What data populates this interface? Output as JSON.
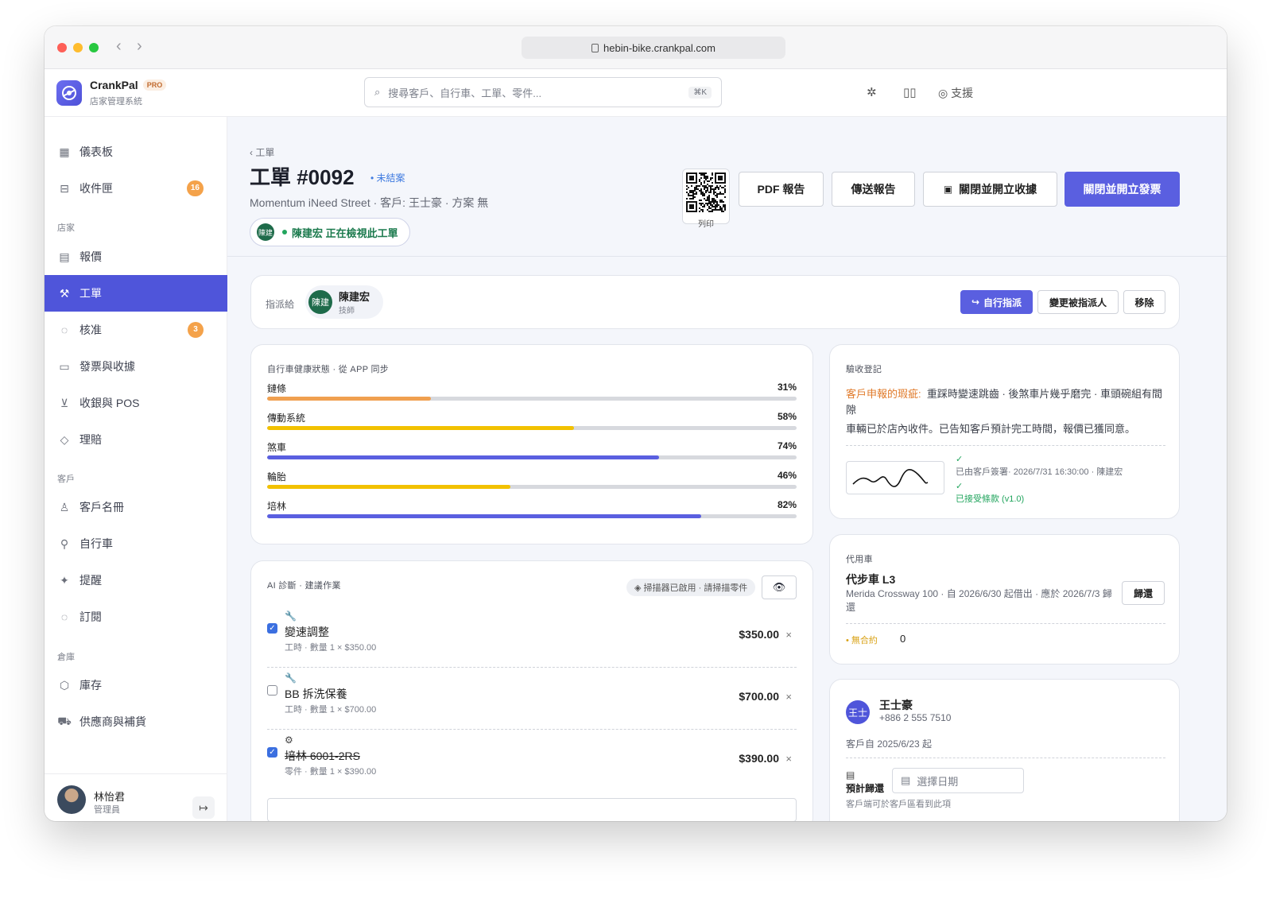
{
  "browser": {
    "url": "hebin-bike.crankpal.com"
  },
  "app": {
    "name": "CrankPal",
    "badge": "PRO",
    "subtitle": "店家管理系統"
  },
  "search": {
    "placeholder": "搜尋客戶、自行車、工單、零件...",
    "shortcut": "⌘K"
  },
  "header": {
    "support_label": "支援"
  },
  "sidebar": {
    "dashboard": "儀表板",
    "inbox": "收件匣",
    "inbox_count": "16",
    "section_store": "店家",
    "quotes": "報價",
    "work_orders": "工單",
    "approvals": "核准",
    "approvals_count": "3",
    "invoices": "發票與收據",
    "pos": "收銀與 POS",
    "claims": "理賠",
    "section_customers": "客戶",
    "directory": "客戶名冊",
    "bikes": "自行車",
    "reminders": "提醒",
    "subscriptions": "訂閱",
    "section_warehouse": "倉庫",
    "inventory": "庫存",
    "suppliers": "供應商與補貨"
  },
  "user": {
    "name": "林怡君",
    "role": "管理員"
  },
  "order": {
    "breadcrumb": "‹ 工單",
    "title": "工單 #0092",
    "status": "• 未結案",
    "subtitle": "Momentum iNeed Street · 客戶: 王士豪 · 方案 無",
    "viewer_initials": "陳建",
    "viewer_text": "陳建宏 正在檢視此工單",
    "qr_label": "列印"
  },
  "actions": {
    "pdf": "PDF 報告",
    "send": "傳送報告",
    "close_receipt": "關閉並開立收據",
    "close_invoice": "關閉並開立發票"
  },
  "assign": {
    "label": "指派給",
    "initials": "陳建",
    "name": "陳建宏",
    "role": "技師",
    "self_assign": "自行指派",
    "change": "變更被指派人",
    "remove": "移除"
  },
  "health": {
    "title": "自行車健康狀態 · 從 APP 同步",
    "items": [
      {
        "label": "鏈條",
        "pct": "31%",
        "value": 31,
        "color": "#f0a050"
      },
      {
        "label": "傳動系統",
        "pct": "58%",
        "value": 58,
        "color": "#f2c100"
      },
      {
        "label": "煞車",
        "pct": "74%",
        "value": 74,
        "color": "#5a5fe0"
      },
      {
        "label": "輪胎",
        "pct": "46%",
        "value": 46,
        "color": "#f2c100"
      },
      {
        "label": "培林",
        "pct": "82%",
        "value": 82,
        "color": "#5a5fe0"
      }
    ]
  },
  "ai": {
    "title": "AI 診斷 · 建議作業",
    "scanner": "◈ 掃描器已啟用 · 請掃描零件",
    "eye_icon": "👁",
    "jobs": [
      {
        "icon": "🔧",
        "name": "變速調整",
        "meta": "工時 · 數量 1 × $350.00",
        "price": "$350.00",
        "checked": true,
        "strike": false
      },
      {
        "icon": "🔧",
        "name": "BB 拆洗保養",
        "meta": "工時 · 數量 1 × $700.00",
        "price": "$700.00",
        "checked": false,
        "strike": false
      },
      {
        "icon": "⚙",
        "name": "培林 6001-2RS",
        "meta": "零件 · 數量 1 × $390.00",
        "price": "$390.00",
        "checked": true,
        "strike": true
      }
    ]
  },
  "intake": {
    "title": "驗收登記",
    "reported_label": "客戶申報的瑕疵:",
    "reported_text": "重踩時變速跳齒 · 後煞車片幾乎磨完 · 車頭碗組有間隙",
    "note": "車輛已於店內收件。已告知客戶預計完工時間，報價已獲同意。",
    "signed": "已由客戶簽署· 2026/7/31 16:30:00 · 陳建宏",
    "terms": "已接受條款 (v1.0)"
  },
  "loaner": {
    "title": "代用車",
    "name": "代步車 L3",
    "meta": "Merida Crossway 100 · 自 2026/6/30 起借出 · 應於 2026/7/3 歸還",
    "return": "歸還",
    "contract_label": "• 無合約",
    "contract_value": "0"
  },
  "customer": {
    "initials": "王士",
    "name": "王士豪",
    "phone": "+886 2 555 7510",
    "since": "客戶自 2025/6/23 起",
    "due_label": "預計歸還",
    "due_placeholder": "選擇日期",
    "note": "客戶端可於客戶區看到此項"
  }
}
